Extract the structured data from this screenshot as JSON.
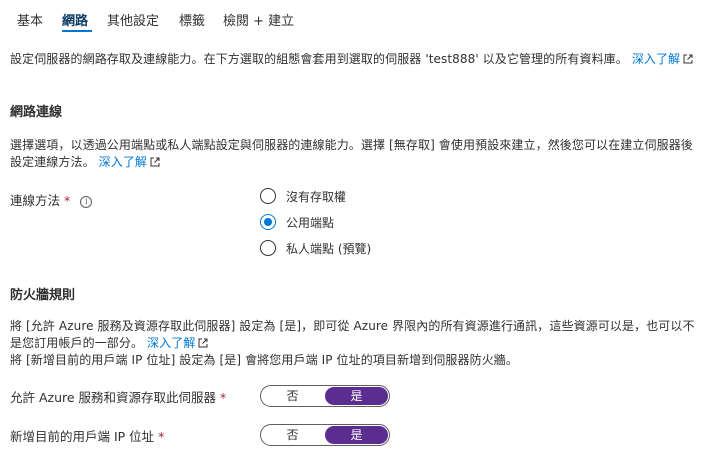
{
  "tabs": [
    {
      "label": "基本"
    },
    {
      "label": "網路"
    },
    {
      "label": "其他設定"
    },
    {
      "label": "標籤"
    },
    {
      "label": "檢閱 + 建立"
    }
  ],
  "intro": {
    "text": "設定伺服器的網路存取及連線能力。在下方選取的組態會套用到選取的伺服器 'test888' 以及它管理的所有資料庫。",
    "link_part1": "深入了",
    "link_part2": "解"
  },
  "connectivity": {
    "heading": "網路連線",
    "desc": "選擇選項，以透過公用端點或私人端點設定與伺服器的連線能力。選擇 [無存取] 會使用預設來建立，然後您可以在建立伺服器後設定連線方法。",
    "link": "深入了解",
    "method_label": "連線方法",
    "required_mark": "*",
    "info_glyph": "i",
    "options": [
      {
        "label": "沒有存取權",
        "checked": false
      },
      {
        "label": "公用端點",
        "checked": true
      },
      {
        "label": "私人端點 (預覽)",
        "checked": false
      }
    ]
  },
  "firewall": {
    "heading": "防火牆規則",
    "desc_line1": "將 [允許 Azure 服務及資源存取此伺服器] 設定為 [是]，即可從 Azure 界限內的所有資源進行通訊，這些資源可以是，也可以不是您訂用帳戶的一部分。",
    "link": "深入了解",
    "desc_line2": "將 [新增目前的用戶端 IP 位址] 設定為 [是] 會將您用戶端 IP 位址的項目新增到伺服器防火牆。",
    "toggles": [
      {
        "label": "允許 Azure 服務和資源存取此伺服器",
        "required": "*",
        "no": "否",
        "yes": "是",
        "selected": "yes"
      },
      {
        "label": "新增目前的用戶端 IP 位址",
        "required": "*",
        "no": "否",
        "yes": "是",
        "selected": "yes"
      }
    ]
  },
  "colors": {
    "accent": "#0078d4",
    "toggle_on": "#5c2d91",
    "required": "#a4262c"
  }
}
